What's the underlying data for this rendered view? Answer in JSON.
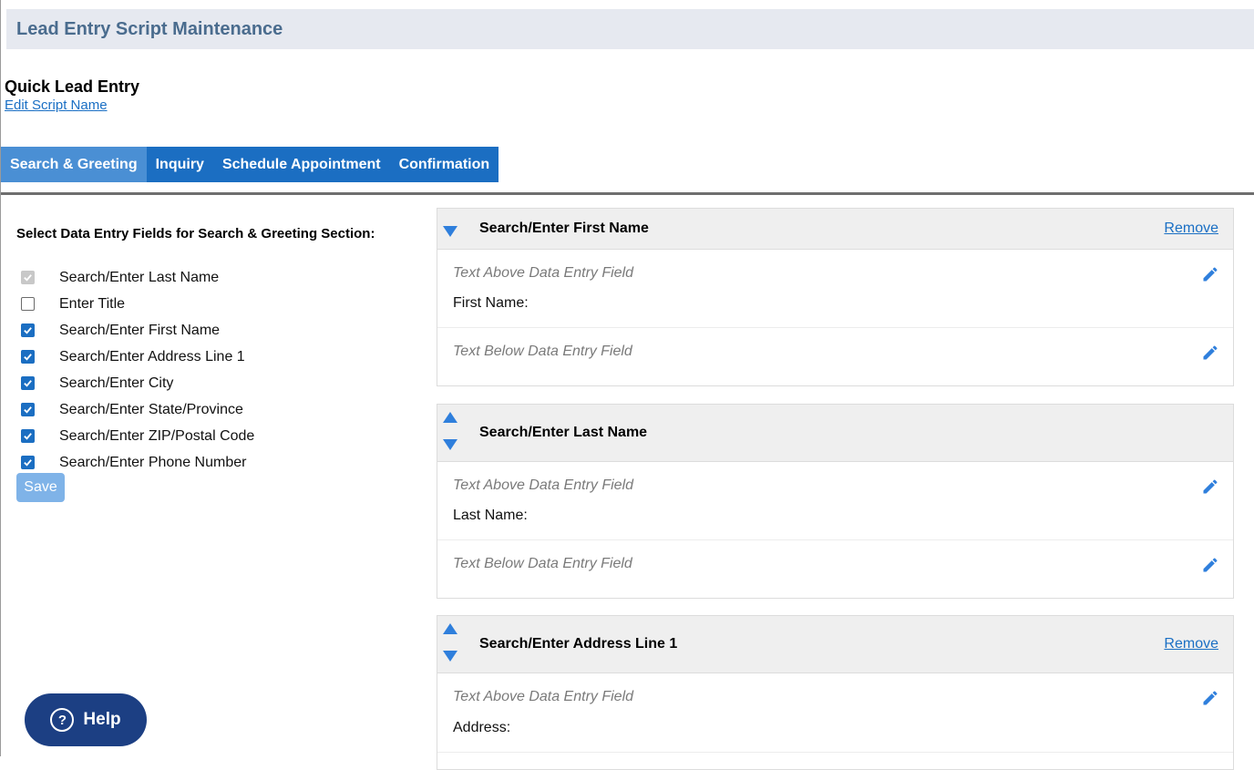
{
  "header": {
    "title": "Lead Entry Script Maintenance"
  },
  "script": {
    "name": "Quick Lead Entry",
    "edit_link": "Edit Script Name"
  },
  "tabs": [
    {
      "label": "Search & Greeting",
      "active": true
    },
    {
      "label": "Inquiry",
      "active": false
    },
    {
      "label": "Schedule Appointment",
      "active": false
    },
    {
      "label": "Confirmation",
      "active": false
    }
  ],
  "left_panel": {
    "heading": "Select Data Entry Fields for Search & Greeting Section:",
    "fields": [
      {
        "label": "Search/Enter Last Name",
        "checked": true,
        "disabled": true
      },
      {
        "label": "Enter Title",
        "checked": false,
        "disabled": false
      },
      {
        "label": "Search/Enter First Name",
        "checked": true,
        "disabled": false
      },
      {
        "label": "Search/Enter Address Line 1",
        "checked": true,
        "disabled": false
      },
      {
        "label": "Search/Enter City",
        "checked": true,
        "disabled": false
      },
      {
        "label": "Search/Enter State/Province",
        "checked": true,
        "disabled": false
      },
      {
        "label": "Search/Enter ZIP/Postal Code",
        "checked": true,
        "disabled": false
      },
      {
        "label": "Search/Enter Phone Number",
        "checked": true,
        "disabled": false
      }
    ],
    "save_label": "Save"
  },
  "cards": [
    {
      "title": "Search/Enter First Name",
      "remove_label": "Remove",
      "above_hint": "Text Above Data Entry Field",
      "field_label": "First Name:",
      "below_hint": "Text Below Data Entry Field"
    },
    {
      "title": "Search/Enter Last Name",
      "remove_label": "",
      "above_hint": "Text Above Data Entry Field",
      "field_label": "Last Name:",
      "below_hint": "Text Below Data Entry Field"
    },
    {
      "title": "Search/Enter Address Line 1",
      "remove_label": "Remove",
      "above_hint": "Text Above Data Entry Field",
      "field_label": "Address:"
    }
  ],
  "help": {
    "label": "Help",
    "icon": "?"
  },
  "colors": {
    "tab": "#1b6ec2",
    "tab_active": "#4a8fd4",
    "link": "#1a6fc4",
    "help": "#1c3f83",
    "arrow": "#2f7fdc"
  }
}
